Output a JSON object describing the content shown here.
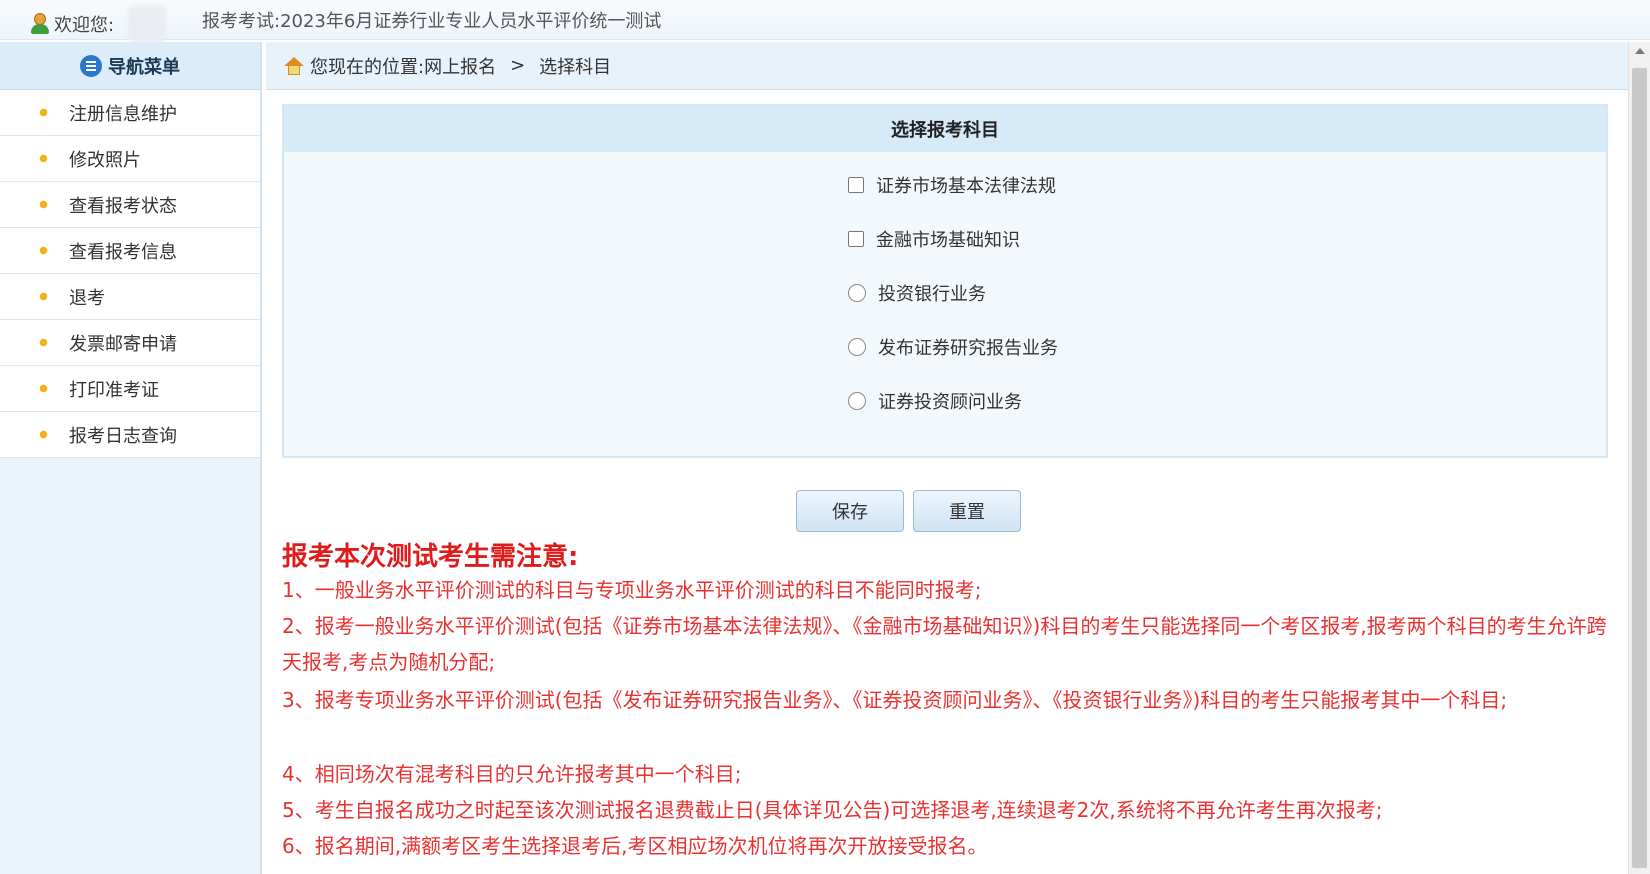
{
  "header": {
    "welcome_label": "欢迎您:",
    "exam_title": "报考考试:2023年6月证券行业专业人员水平评价统一测试"
  },
  "sidebar": {
    "title": "导航菜单",
    "items": [
      {
        "label": "注册信息维护"
      },
      {
        "label": "修改照片"
      },
      {
        "label": "查看报考状态"
      },
      {
        "label": "查看报考信息"
      },
      {
        "label": "退考"
      },
      {
        "label": "发票邮寄申请"
      },
      {
        "label": "打印准考证"
      },
      {
        "label": "报考日志查询"
      }
    ]
  },
  "breadcrumb": {
    "prefix": "您现在的位置:",
    "level1": "网上报名",
    "separator": ">",
    "level2": "选择科目"
  },
  "subject_panel": {
    "title": "选择报考科目",
    "options": [
      {
        "type": "checkbox",
        "label": "证券市场基本法律法规",
        "checked": false
      },
      {
        "type": "checkbox",
        "label": "金融市场基础知识",
        "checked": false
      },
      {
        "type": "radio",
        "label": "投资银行业务",
        "checked": false
      },
      {
        "type": "radio",
        "label": "发布证券研究报告业务",
        "checked": false
      },
      {
        "type": "radio",
        "label": "证券投资顾问业务",
        "checked": false
      }
    ]
  },
  "buttons": {
    "save": "保存",
    "reset": "重置"
  },
  "notice": {
    "title": "报考本次测试考生需注意:",
    "items": [
      "1、一般业务水平评价测试的科目与专项业务水平评价测试的科目不能同时报考;",
      "2、报考一般业务水平评价测试(包括《证券市场基本法律法规》、《金融市场基础知识》)科目的考生只能选择同一个考区报考,报考两个科目的考生允许跨天报考,考点为随机分配;",
      "3、报考专项业务水平评价测试(包括《发布证券研究报告业务》、《证券投资顾问业务》、《投资银行业务》)科目的考生只能报考其中一个科目;",
      "4、相同场次有混考科目的只允许报考其中一个科目;",
      "5、考生自报名成功之时起至该次测试报名退费截止日(具体详见公告)可选择退考,连续退考2次,系统将不再允许考生再次报考;",
      "6、报名期间,满额考区考生选择退考后,考区相应场次机位将再次开放接受报名。"
    ]
  },
  "colors": {
    "notice_red": "#e83232",
    "panel_header_blue": "#d7eaf7",
    "bullet_yellow": "#f2b211"
  }
}
